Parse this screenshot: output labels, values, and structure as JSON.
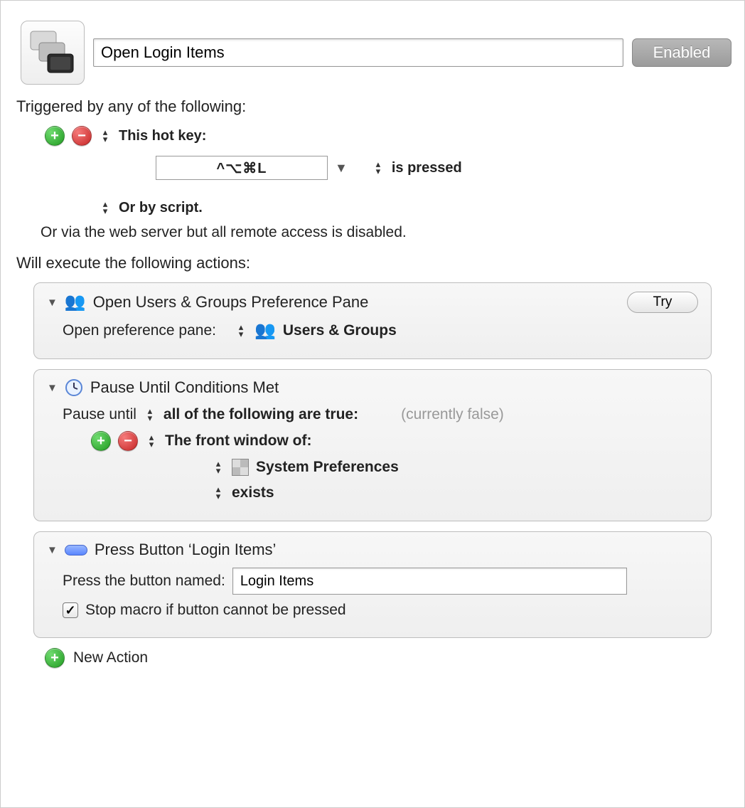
{
  "header": {
    "macro_name": "Open Login Items",
    "enabled_label": "Enabled"
  },
  "triggers": {
    "intro": "Triggered by any of the following:",
    "hotkey_label": "This hot key:",
    "hotkey_value": "^⌥⌘L",
    "is_pressed": "is pressed",
    "or_script": "Or by script.",
    "remote_note": "Or via the web server but all remote access is disabled."
  },
  "actions": {
    "intro": "Will execute the following actions:",
    "try_label": "Try",
    "a1": {
      "title": "Open Users & Groups Preference Pane",
      "line_label": "Open preference pane:",
      "pane_name": "Users & Groups"
    },
    "a2": {
      "title": "Pause Until Conditions Met",
      "line_label": "Pause until",
      "condition_mode": "all of the following are true:",
      "status": "(currently false)",
      "cond_label": "The front window of:",
      "app_name": "System Preferences",
      "predicate": "exists"
    },
    "a3": {
      "title": "Press Button ‘Login Items’",
      "line_label": "Press the button named:",
      "button_value": "Login Items",
      "stop_label": "Stop macro if button cannot be pressed"
    },
    "new_action": "New Action"
  }
}
